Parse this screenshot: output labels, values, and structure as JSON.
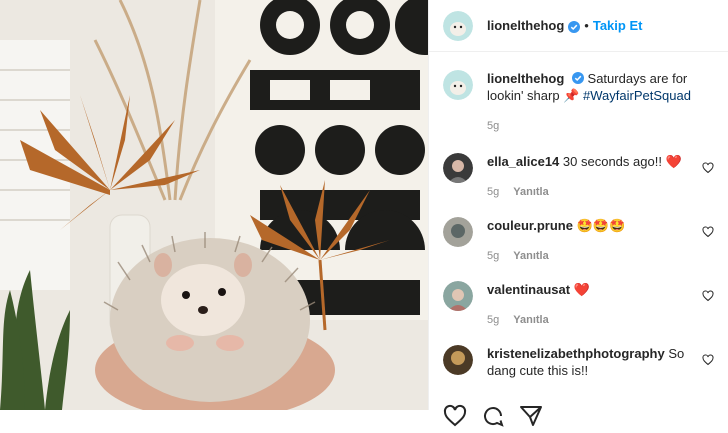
{
  "post": {
    "username": "lionelthehog",
    "follow_label": "Takip Et",
    "caption_text": "Saturdays are for lookin' sharp",
    "caption_emoji": "📌",
    "hashtag": "#WayfairPetSquad",
    "caption_time": "5g"
  },
  "comments": [
    {
      "username": "ella_alice14",
      "text": "30 seconds ago!!",
      "emoji": "❤️",
      "time": "5g",
      "reply": "Yanıtla"
    },
    {
      "username": "couleur.prune",
      "text": "",
      "emoji": "🤩🤩🤩",
      "time": "5g",
      "reply": "Yanıtla"
    },
    {
      "username": "valentinausat",
      "text": "",
      "emoji": "❤️",
      "time": "5g",
      "reply": "Yanıtla"
    },
    {
      "username": "kristenelizabethphotography",
      "text": "So dang cute this is!!",
      "emoji": "",
      "time": "",
      "reply": ""
    }
  ],
  "colors": {
    "link": "#0095f6",
    "hashtag": "#00376b",
    "meta": "#8e8e8e",
    "verified": "#3897f0"
  }
}
